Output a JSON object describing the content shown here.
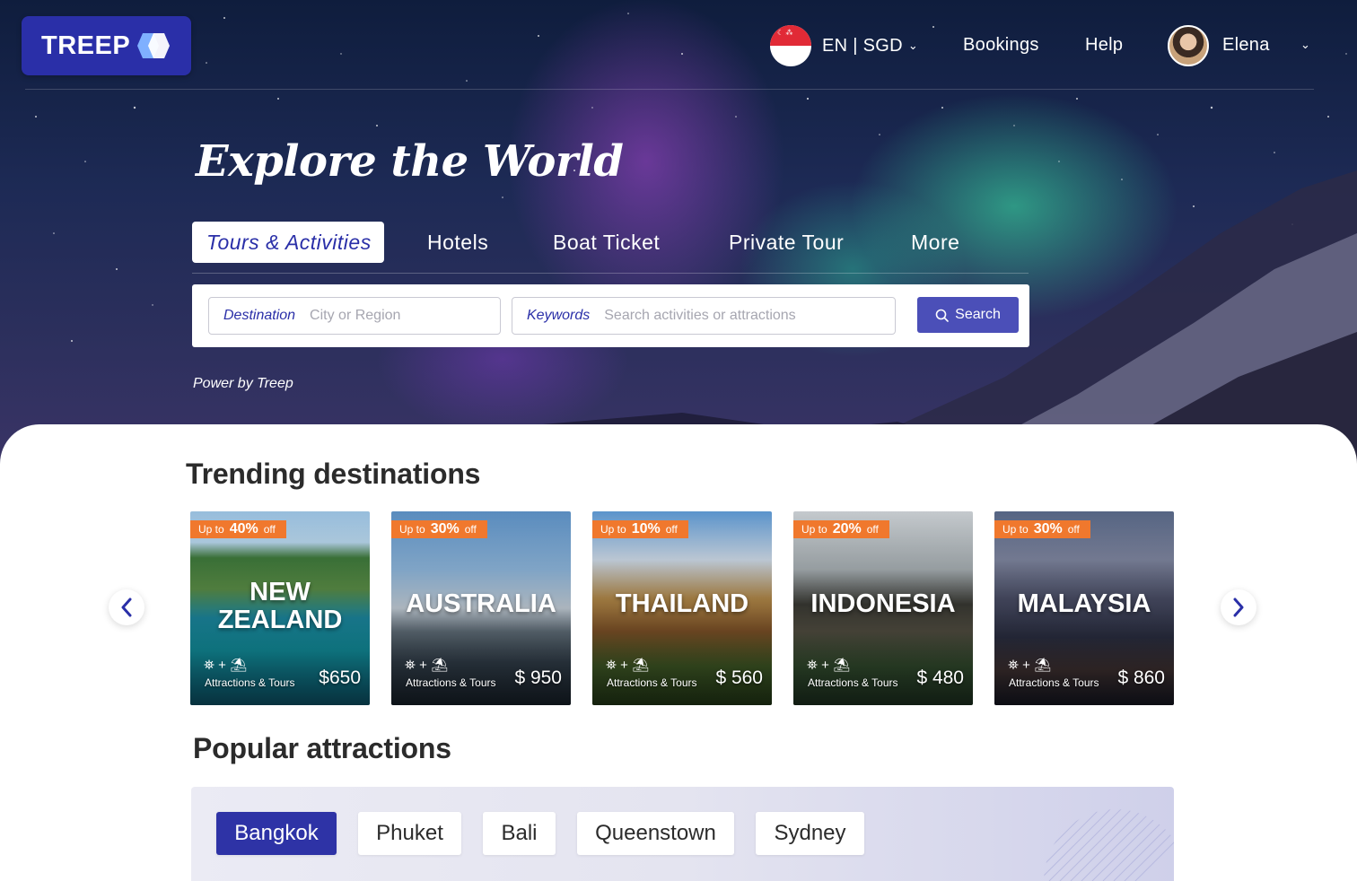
{
  "header": {
    "logo_text": "TREEP",
    "language_currency": "EN | SGD",
    "links": [
      "Bookings",
      "Help"
    ],
    "user_name": "Elena"
  },
  "hero": {
    "headline": "Explore the World",
    "tabs": [
      {
        "label": "Tours & Activities",
        "active": true
      },
      {
        "label": "Hotels",
        "active": false
      },
      {
        "label": "Boat Ticket",
        "active": false
      },
      {
        "label": "Private Tour",
        "active": false
      },
      {
        "label": "More",
        "active": false
      }
    ],
    "search": {
      "destination_label": "Destination",
      "destination_placeholder": "City or Region",
      "keywords_label": "Keywords",
      "keywords_placeholder": "Search activities or attractions",
      "button_label": "Search"
    },
    "power_text": "Power by Treep"
  },
  "trending": {
    "title": "Trending destinations",
    "badge_prefix": "Up to",
    "badge_suffix": "off",
    "icons_text": "⛯ + ⛱",
    "cards": [
      {
        "name": "NEW ZEALAND",
        "discount": "40%",
        "type": "Attractions & Tours",
        "price": "$650"
      },
      {
        "name": "AUSTRALIA",
        "discount": "30%",
        "type": "Attractions & Tours",
        "price": "$ 950"
      },
      {
        "name": "THAILAND",
        "discount": "10%",
        "type": "Attractions & Tours",
        "price": "$ 560"
      },
      {
        "name": "INDONESIA",
        "discount": "20%",
        "type": "Attractions & Tours",
        "price": "$ 480"
      },
      {
        "name": "MALAYSIA",
        "discount": "30%",
        "type": "Attractions & Tours",
        "price": "$ 860"
      }
    ]
  },
  "popular": {
    "title": "Popular attractions",
    "cities": [
      {
        "label": "Bangkok",
        "active": true
      },
      {
        "label": "Phuket",
        "active": false
      },
      {
        "label": "Bali",
        "active": false
      },
      {
        "label": "Queenstown",
        "active": false
      },
      {
        "label": "Sydney",
        "active": false
      }
    ]
  },
  "colors": {
    "brand": "#2a2fa8",
    "search_button": "#4b4fb8",
    "badge": "#f0782d"
  }
}
